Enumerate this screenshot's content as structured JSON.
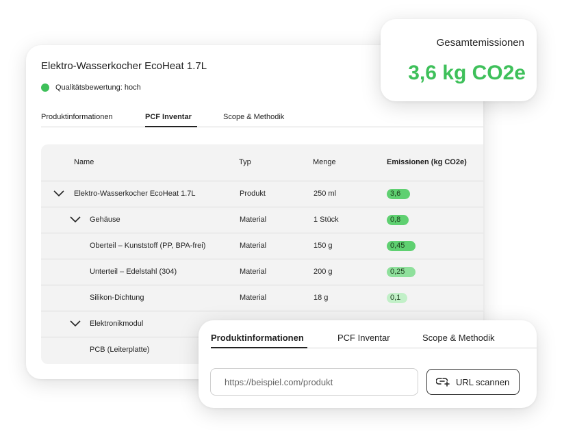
{
  "product": {
    "title": "Elektro-Wasserkocher EcoHeat 1.7L",
    "quality": "Qualitätsbewertung: hoch"
  },
  "tabs": [
    "Produktinformationen",
    "PCF Inventar",
    "Scope & Methodik"
  ],
  "active_tab": "PCF Inventar",
  "table": {
    "headers": [
      "Name",
      "Typ",
      "Menge",
      "Emissionen (kg CO2e)"
    ],
    "rows": [
      {
        "name": "Elektro-Wasserkocher EcoHeat 1.7L",
        "type": "Produkt",
        "amount": "250 ml",
        "emission": "3,6",
        "level": 0,
        "expandable": true
      },
      {
        "name": "Gehäuse",
        "type": "Material",
        "amount": "1 Stück",
        "emission": "0,8",
        "level": 1,
        "expandable": true
      },
      {
        "name": "Oberteil – Kunststoff (PP, BPA-frei)",
        "type": "Material",
        "amount": "150 g",
        "emission": "0,45",
        "level": 2,
        "expandable": false
      },
      {
        "name": "Unterteil – Edelstahl (304)",
        "type": "Material",
        "amount": "200 g",
        "emission": "0,25",
        "level": 2,
        "expandable": false
      },
      {
        "name": "Silikon-Dichtung",
        "type": "Material",
        "amount": "18 g",
        "emission": "0,1",
        "level": 2,
        "expandable": false
      },
      {
        "name": "Elektronikmodul",
        "type": "",
        "amount": "",
        "emission": "",
        "level": 1,
        "expandable": true
      },
      {
        "name": "PCB (Leiterplatte)",
        "type": "",
        "amount": "",
        "emission": "",
        "level": 2,
        "expandable": false
      }
    ]
  },
  "emissions_card": {
    "label": "Gesamtemissionen",
    "value": "3,6 kg CO2e"
  },
  "url_card": {
    "tabs": [
      "Produktinformationen",
      "PCF Inventar",
      "Scope & Methodik"
    ],
    "active_tab": "Produktinformationen",
    "input_placeholder": "https://beispiel.com/produkt",
    "input_value": "",
    "scan_button_label": "URL scannen",
    "scan_icon": "link-scan-icon"
  },
  "colors": {
    "accent_green": "#3ec05a",
    "pill_strong": "#5fd071",
    "pill_medium": "#8fe09c",
    "pill_light": "#c2f0c8"
  }
}
